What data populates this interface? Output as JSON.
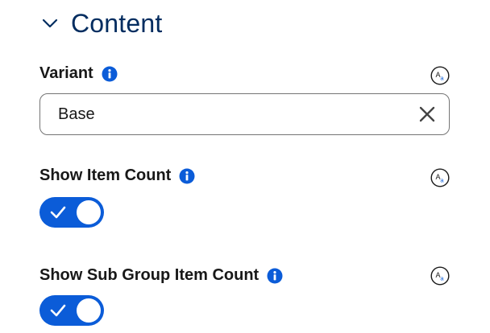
{
  "section": {
    "title": "Content"
  },
  "variant": {
    "label": "Variant",
    "value": "Base"
  },
  "show_item_count": {
    "label": "Show Item Count",
    "enabled": true
  },
  "show_sub_group_item_count": {
    "label": "Show Sub Group Item Count",
    "enabled": true
  },
  "colors": {
    "title": "#032d60",
    "accent": "#0b5cd8",
    "text": "#181818",
    "border": "#747474"
  },
  "icons": {
    "section_toggle": "chevron-down-icon",
    "info": "info-icon",
    "translate": "translate-icon",
    "clear": "close-icon",
    "toggle_check": "check-icon"
  }
}
